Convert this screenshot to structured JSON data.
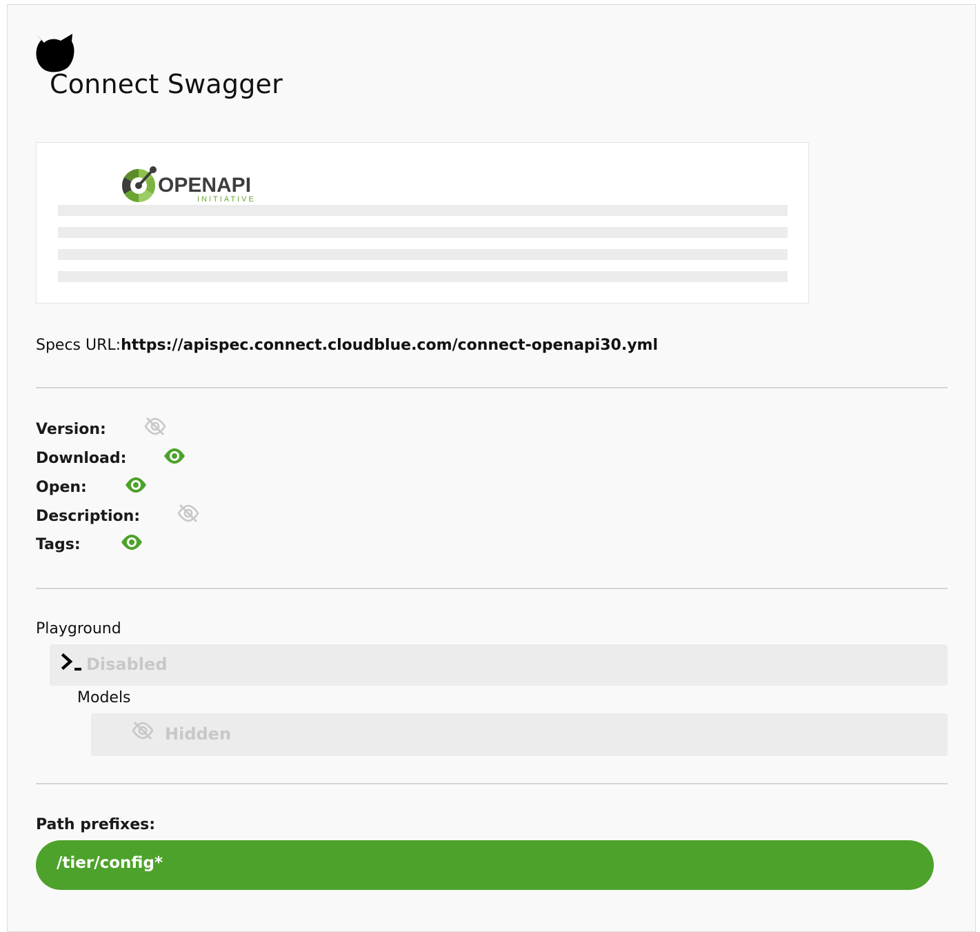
{
  "header": {
    "title": "Connect Swagger"
  },
  "specs": {
    "label": "Specs URL:",
    "url": "https://apispec.connect.cloudblue.com/connect-openapi30.yml"
  },
  "logo": {
    "brand": "OPENAPI",
    "tagline": "INITIATIVE"
  },
  "properties": [
    {
      "label": "Version:",
      "visible": false
    },
    {
      "label": "Download:",
      "visible": true
    },
    {
      "label": "Open:",
      "visible": true
    },
    {
      "label": "Description:",
      "visible": false
    },
    {
      "label": "Tags:",
      "visible": true
    }
  ],
  "playground": {
    "label": "Playground",
    "status": "Disabled"
  },
  "models": {
    "label": "Models",
    "status": "Hidden"
  },
  "path_prefixes": {
    "label": "Path prefixes:",
    "items": [
      "/tier/config*"
    ]
  },
  "colors": {
    "accent": "#4da22b",
    "muted": "#c8c8c8",
    "panel": "#ececec"
  }
}
